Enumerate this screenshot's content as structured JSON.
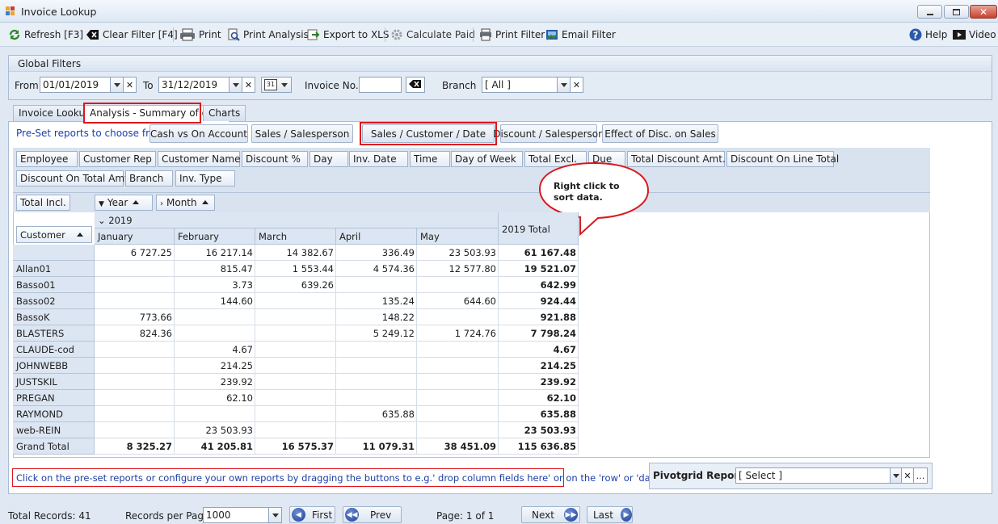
{
  "window": {
    "title": "Invoice Lookup"
  },
  "toolbar": {
    "refresh": "Refresh [F3]",
    "clear_filter": "Clear Filter [F4]",
    "print": "Print",
    "print_analysis": "Print Analysis",
    "export_xls": "Export to XLS",
    "calculate_paid": "Calculate Paid",
    "print_filter": "Print Filter",
    "email_filter": "Email Filter",
    "help": "Help",
    "video": "Video"
  },
  "global_filters": {
    "title": "Global Filters",
    "from_label": "From",
    "from_value": "01/01/2019",
    "to_label": "To",
    "to_value": "31/12/2019",
    "calendar_label": "31",
    "invoice_label": "Invoice No.",
    "invoice_value": "",
    "branch_label": "Branch",
    "branch_value": "[ All ]"
  },
  "tabs": [
    "Invoice Lookup",
    "Analysis - Summary of data",
    "Charts"
  ],
  "presets": {
    "label": "Pre-Set reports to choose from:",
    "items": [
      "Cash vs On Account",
      "Sales / Salesperson",
      "Sales / Customer / Date",
      "Discount / Salesperson",
      "Effect of Disc. on Sales"
    ]
  },
  "filter_fields": [
    "Employee",
    "Customer Rep",
    "Customer Name",
    "Discount %",
    "Day",
    "Inv. Date",
    "Time",
    "Day of Week",
    "Total Excl.",
    "Due",
    "Total Discount Amt.",
    "Discount On Line Total",
    "Discount On Total Amt",
    "Branch",
    "Inv. Type"
  ],
  "data_field": "Total Incl.",
  "column_fields": [
    "Year",
    "Month"
  ],
  "row_field": "Customer",
  "callout": "Right click to sort data.",
  "pivot": {
    "year": "2019",
    "months": [
      "January",
      "February",
      "March",
      "April",
      "May"
    ],
    "total_header": "2019 Total",
    "rows": [
      {
        "name": "",
        "values": [
          "6 727.25",
          "16 217.14",
          "14 382.67",
          "336.49",
          "23 503.93"
        ],
        "total": "61 167.48"
      },
      {
        "name": "Allan01",
        "values": [
          "",
          "815.47",
          "1 553.44",
          "4 574.36",
          "12 577.80"
        ],
        "total": "19 521.07"
      },
      {
        "name": "Basso01",
        "values": [
          "",
          "3.73",
          "639.26",
          "",
          ""
        ],
        "total": "642.99"
      },
      {
        "name": "Basso02",
        "values": [
          "",
          "144.60",
          "",
          "135.24",
          "644.60"
        ],
        "total": "924.44"
      },
      {
        "name": "BassoK",
        "values": [
          "773.66",
          "",
          "",
          "148.22",
          ""
        ],
        "total": "921.88"
      },
      {
        "name": "BLASTERS",
        "values": [
          "824.36",
          "",
          "",
          "5 249.12",
          "1 724.76"
        ],
        "total": "7 798.24"
      },
      {
        "name": "CLAUDE-cod",
        "values": [
          "",
          "4.67",
          "",
          "",
          ""
        ],
        "total": "4.67"
      },
      {
        "name": "JOHNWEBB",
        "values": [
          "",
          "214.25",
          "",
          "",
          ""
        ],
        "total": "214.25"
      },
      {
        "name": "JUSTSKIL",
        "values": [
          "",
          "239.92",
          "",
          "",
          ""
        ],
        "total": "239.92"
      },
      {
        "name": "PREGAN",
        "values": [
          "",
          "62.10",
          "",
          "",
          ""
        ],
        "total": "62.10"
      },
      {
        "name": "RAYMOND",
        "values": [
          "",
          "",
          "",
          "635.88",
          ""
        ],
        "total": "635.88"
      },
      {
        "name": "web-REIN",
        "values": [
          "",
          "23 503.93",
          "",
          "",
          ""
        ],
        "total": "23 503.93"
      }
    ],
    "grand_total": {
      "name": "Grand Total",
      "values": [
        "8 325.27",
        "41 205.81",
        "16 575.37",
        "11 079.31",
        "38 451.09"
      ],
      "total": "115 636.85"
    }
  },
  "hint": "Click on the pre-set reports  or configure your own reports by dragging the buttons to e.g.' drop column fields here' or on the 'row' or 'data.'",
  "pivot_report": {
    "label": "Pivotgrid Report:",
    "value": "[ Select ]"
  },
  "status": {
    "total_records": "Total Records: 41",
    "per_page_label": "Records per Page:",
    "per_page_value": "1000",
    "first": "First",
    "prev": "Prev",
    "page": "Page: 1 of 1",
    "next": "Next",
    "last": "Last"
  }
}
